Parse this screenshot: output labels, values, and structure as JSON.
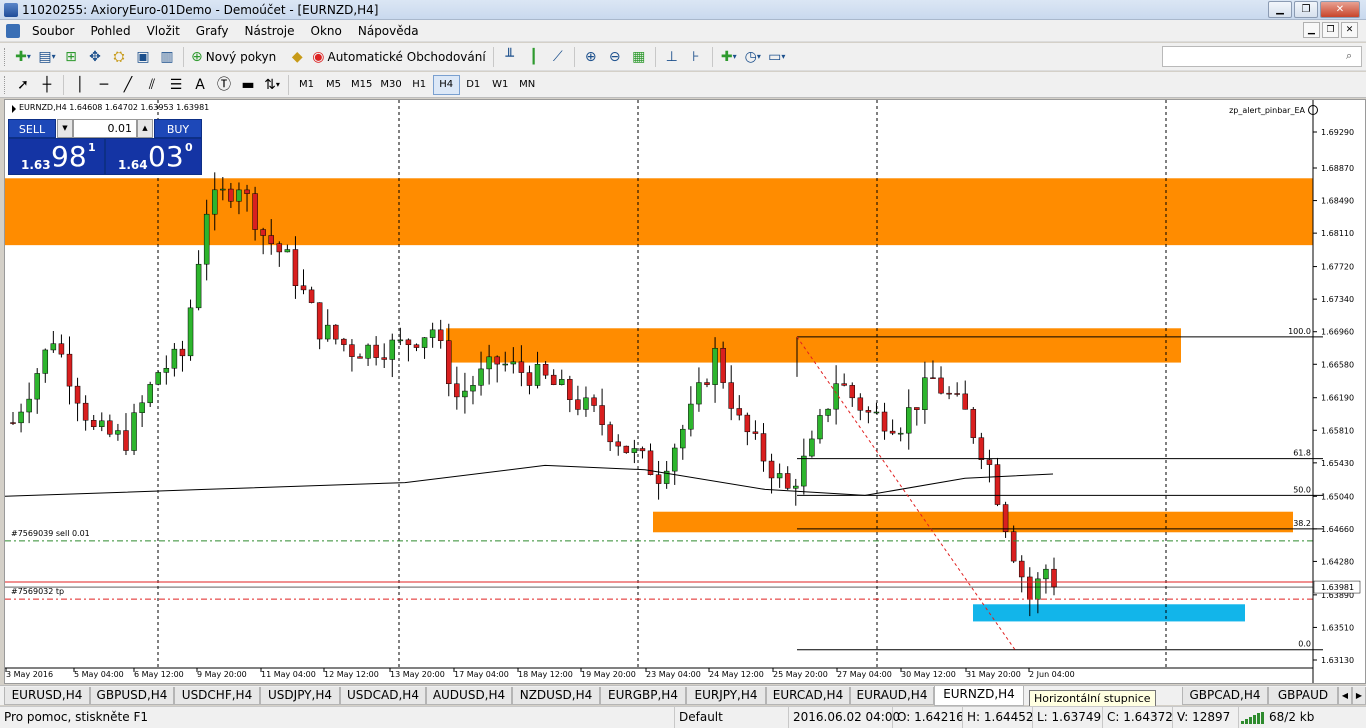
{
  "window": {
    "title": "11020255: AxioryEuro-01Demo - Demoúčet - [EURNZD,H4]"
  },
  "window_buttons": [
    "▁",
    "❐",
    "✕"
  ],
  "mdi_buttons": [
    "▁",
    "❐",
    "✕"
  ],
  "menu": [
    "Soubor",
    "Pohled",
    "Vložit",
    "Grafy",
    "Nástroje",
    "Okno",
    "Nápověda"
  ],
  "toolbar": {
    "new_order": "Nový pokyn",
    "auto_trading": "Automatické Obchodování"
  },
  "timeframes": [
    "M1",
    "M5",
    "M15",
    "M30",
    "H1",
    "H4",
    "D1",
    "W1",
    "MN"
  ],
  "active_timeframe": "H4",
  "search": {
    "value": ""
  },
  "chart": {
    "header": "EURNZD,H4  1.64608 1.64702 1.63953 1.63981",
    "ea_label": "zp_alert_pinbar_EA",
    "order_label": "#7569039 sell 0.01",
    "tp_label": "#7569032 tp",
    "current_price_label": "1.63981"
  },
  "chart_data": {
    "type": "candlestick",
    "symbol": "EURNZD",
    "timeframe": "H4",
    "y_ticks": [
      "1.69290",
      "1.68870",
      "1.68490",
      "1.68110",
      "1.67720",
      "1.67340",
      "1.66960",
      "1.66580",
      "1.66190",
      "1.65810",
      "1.65430",
      "1.65040",
      "1.64660",
      "1.64280",
      "1.63890",
      "1.63510",
      "1.63130"
    ],
    "ylim": [
      1.6313,
      1.6929
    ],
    "x_labels": [
      "3 May 2016",
      "5 May 04:00",
      "6 May 12:00",
      "9 May 20:00",
      "11 May 04:00",
      "12 May 12:00",
      "13 May 20:00",
      "17 May 04:00",
      "18 May 12:00",
      "19 May 20:00",
      "23 May 04:00",
      "24 May 12:00",
      "25 May 20:00",
      "27 May 04:00",
      "30 May 12:00",
      "31 May 20:00",
      "2 Jun 04:00"
    ],
    "fib_levels": [
      "100.0",
      "61.8",
      "50.0",
      "38.2",
      "0.0"
    ],
    "last_price": "1.63981",
    "colors": {
      "bull": "#2db52d",
      "bear": "#d91f1f",
      "zone": "#ff8c00",
      "target": "#12b5ea",
      "ma": "#000000"
    }
  },
  "one_click": {
    "sell_label": "SELL",
    "buy_label": "BUY",
    "lot": "0.01",
    "sell": {
      "prefix": "1.63",
      "big": "98",
      "sup": "1"
    },
    "buy": {
      "prefix": "1.64",
      "big": "03",
      "sup": "0"
    }
  },
  "tabs": [
    "EURUSD,H4",
    "GBPUSD,H4",
    "USDCHF,H4",
    "USDJPY,H4",
    "USDCAD,H4",
    "AUDUSD,H4",
    "NZDUSD,H4",
    "EURGBP,H4",
    "EURJPY,H4",
    "EURCAD,H4",
    "EURAUD,H4",
    "EURNZD,H4",
    "GBPCAD,H4",
    "GBPAUD"
  ],
  "active_tab": "EURNZD,H4",
  "tooltip": "Horizontální stupnice",
  "status": {
    "help": "Pro pomoc, stiskněte F1",
    "profile": "Default",
    "datetime": "2016.06.02 04:00",
    "open": "O: 1.64216",
    "high": "H: 1.64452",
    "low": "L: 1.63749",
    "close": "C: 1.64372",
    "volume": "V: 12897",
    "traffic": "68/2 kb"
  }
}
